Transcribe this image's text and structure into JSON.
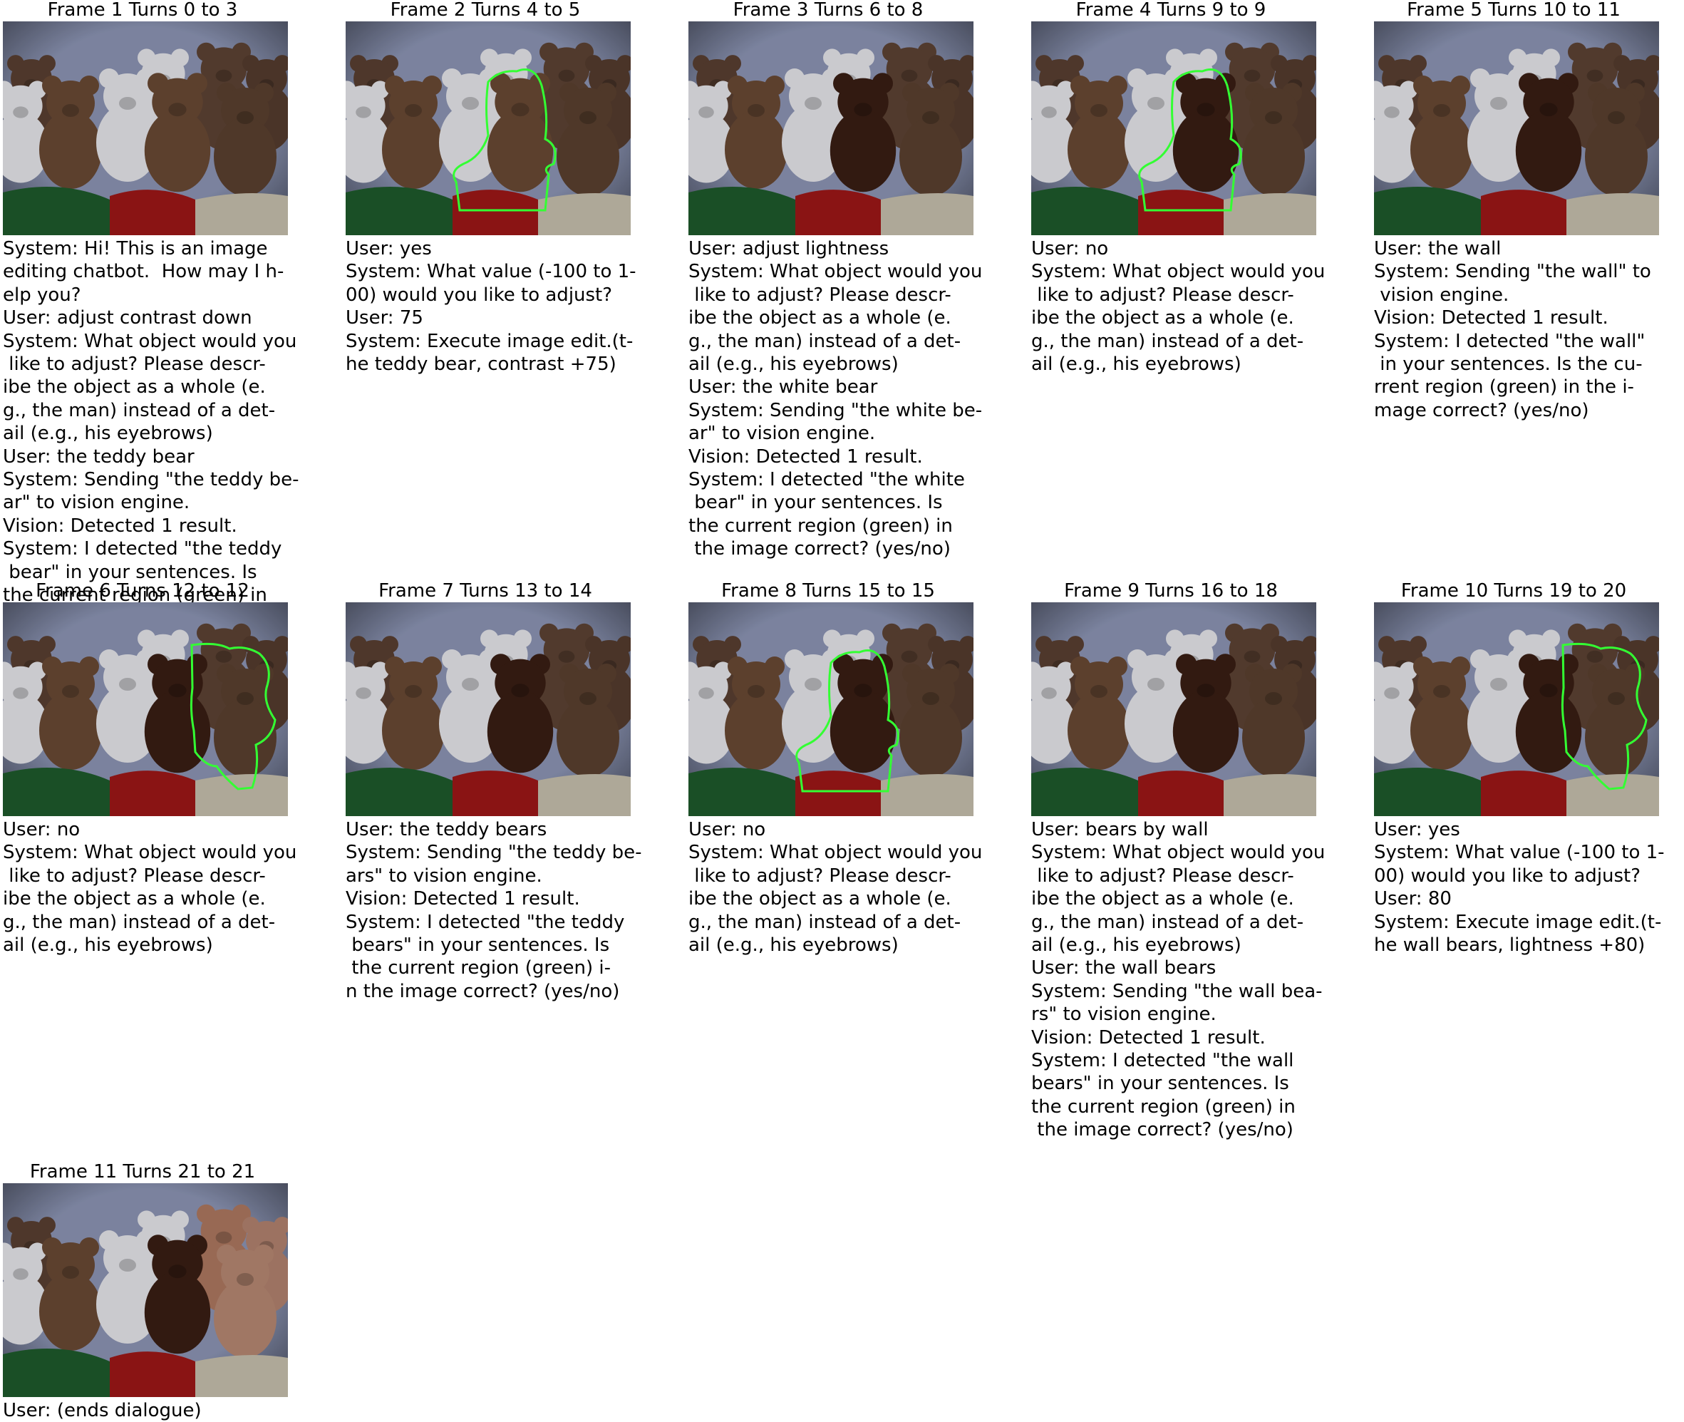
{
  "frames": [
    {
      "title": "Frame 1 Turns 0 to 3",
      "image": "teddy-bears-photo",
      "highlight": "none",
      "edits": [],
      "lines": [
        "System: Hi! This is an image",
        "editing chatbot.  How may I h-",
        "elp you?",
        "User: adjust contrast down",
        "System: What object would you",
        " like to adjust? Please descr-",
        "ibe the object as a whole (e.",
        "g., the man) instead of a det-",
        "ail (e.g., his eyebrows)",
        "User: the teddy bear",
        "System: Sending \"the teddy be-",
        "ar\" to vision engine.",
        "Vision: Detected 1 result.",
        "System: I detected \"the teddy",
        " bear\" in your sentences. Is",
        "the current region (green) in"
      ]
    },
    {
      "title": "Frame 2 Turns 4 to 5",
      "image": "teddy-bears-photo",
      "highlight": "center-bear",
      "edits": [],
      "lines": [
        "User: yes",
        "System: What value (-100 to 1-",
        "00) would you like to adjust?",
        "User: 75",
        "System: Execute image edit.(t-",
        "he teddy bear, contrast +75)"
      ]
    },
    {
      "title": "Frame 3 Turns 6 to 8",
      "image": "teddy-bears-photo",
      "highlight": "none",
      "edits": [
        "center-contrast"
      ],
      "lines": [
        "User: adjust lightness",
        "System: What object would you",
        " like to adjust? Please descr-",
        "ibe the object as a whole (e.",
        "g., the man) instead of a det-",
        "ail (e.g., his eyebrows)",
        "User: the white bear",
        "System: Sending \"the white be-",
        "ar\" to vision engine.",
        "Vision: Detected 1 result.",
        "System: I detected \"the white",
        " bear\" in your sentences. Is",
        "the current region (green) in",
        " the image correct? (yes/no)"
      ]
    },
    {
      "title": "Frame 4 Turns 9 to 9",
      "image": "teddy-bears-photo",
      "highlight": "center-bear",
      "edits": [
        "center-contrast"
      ],
      "lines": [
        "User: no",
        "System: What object would you",
        " like to adjust? Please descr-",
        "ibe the object as a whole (e.",
        "g., the man) instead of a det-",
        "ail (e.g., his eyebrows)"
      ]
    },
    {
      "title": "Frame 5 Turns 10 to 11",
      "image": "teddy-bears-photo",
      "highlight": "none",
      "edits": [
        "center-contrast"
      ],
      "lines": [
        "User: the wall",
        "System: Sending \"the wall\" to",
        " vision engine.",
        "Vision: Detected 1 result.",
        "System: I detected \"the wall\"",
        " in your sentences. Is the cu-",
        "rrent region (green) in the i-",
        "mage correct? (yes/no)"
      ]
    },
    {
      "title": "Frame 6 Turns 12 to 12",
      "image": "teddy-bears-photo",
      "highlight": "right-bears",
      "edits": [
        "center-contrast"
      ],
      "lines": [
        "User: no",
        "System: What object would you",
        " like to adjust? Please descr-",
        "ibe the object as a whole (e.",
        "g., the man) instead of a det-",
        "ail (e.g., his eyebrows)"
      ]
    },
    {
      "title": "Frame 7 Turns 13 to 14",
      "image": "teddy-bears-photo",
      "highlight": "none",
      "edits": [
        "center-contrast"
      ],
      "lines": [
        "User: the teddy bears",
        "System: Sending \"the teddy be-",
        "ars\" to vision engine.",
        "Vision: Detected 1 result.",
        "System: I detected \"the teddy",
        " bears\" in your sentences. Is",
        " the current region (green) i-",
        "n the image correct? (yes/no)"
      ]
    },
    {
      "title": "Frame 8 Turns 15 to 15",
      "image": "teddy-bears-photo",
      "highlight": "center-bear",
      "edits": [
        "center-contrast"
      ],
      "lines": [
        "User: no",
        "System: What object would you",
        " like to adjust? Please descr-",
        "ibe the object as a whole (e.",
        "g., the man) instead of a det-",
        "ail (e.g., his eyebrows)"
      ]
    },
    {
      "title": "Frame 9 Turns 16 to 18",
      "image": "teddy-bears-photo",
      "highlight": "none",
      "edits": [
        "center-contrast"
      ],
      "lines": [
        "User: bears by wall",
        "System: What object would you",
        " like to adjust? Please descr-",
        "ibe the object as a whole (e.",
        "g., the man) instead of a det-",
        "ail (e.g., his eyebrows)",
        "User: the wall bears",
        "System: Sending \"the wall bea-",
        "rs\" to vision engine.",
        "Vision: Detected 1 result.",
        "System: I detected \"the wall",
        "bears\" in your sentences. Is",
        "the current region (green) in",
        " the image correct? (yes/no)"
      ]
    },
    {
      "title": "Frame 10 Turns 19 to 20",
      "image": "teddy-bears-photo",
      "highlight": "right-bears",
      "edits": [
        "center-contrast"
      ],
      "lines": [
        "User: yes",
        "System: What value (-100 to 1-",
        "00) would you like to adjust?",
        "User: 80",
        "System: Execute image edit.(t-",
        "he wall bears, lightness +80)"
      ]
    },
    {
      "title": "Frame 11 Turns 21 to 21",
      "image": "teddy-bears-photo",
      "highlight": "none",
      "edits": [
        "center-contrast",
        "right-lightness"
      ],
      "lines": [
        "User: (ends dialogue)"
      ]
    }
  ],
  "colors": {
    "highlight": "#33ff33",
    "wall": "#8e97b7",
    "blanket_red": "#a01818",
    "blanket_green": "#1f5c2c",
    "bear_brown": "#6b4a35",
    "bear_white": "#e9e9ee"
  }
}
